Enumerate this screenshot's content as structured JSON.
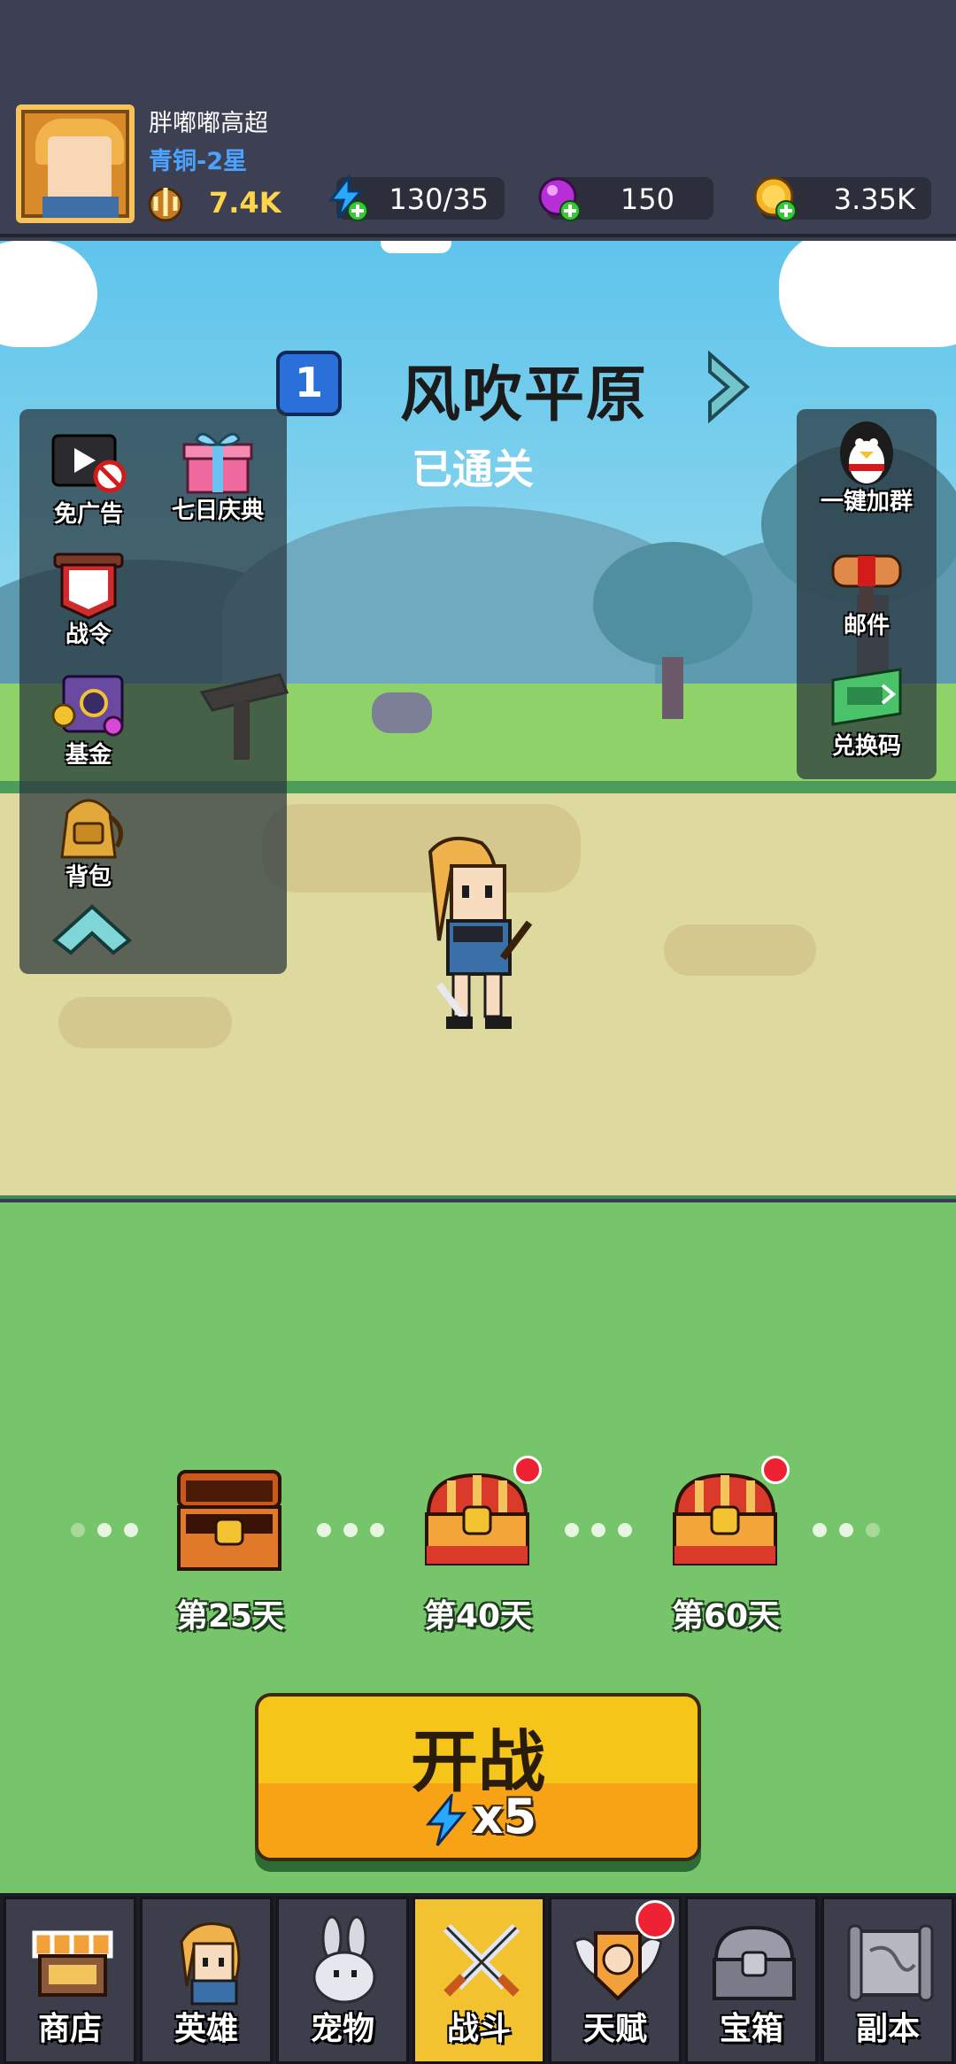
{
  "player": {
    "name": "胖嘟嘟高超",
    "rank": "青铜-2星",
    "power": "7.4K"
  },
  "resources": {
    "energy": "130/35",
    "gems": "150",
    "coins": "3.35K"
  },
  "stage": {
    "number": "1",
    "name": "风吹平原",
    "status": "已通关"
  },
  "left_panel": [
    {
      "label": "免广告",
      "icon": "ad-free-icon"
    },
    {
      "label": "七日庆典",
      "icon": "gift-box-icon"
    },
    {
      "label": "战令",
      "icon": "battle-pass-icon"
    },
    {
      "label": "基金",
      "icon": "fund-safe-icon"
    },
    {
      "label": "背包",
      "icon": "backpack-icon"
    }
  ],
  "right_panel": [
    {
      "label": "一键加群",
      "icon": "penguin-icon"
    },
    {
      "label": "邮件",
      "icon": "mailbox-icon"
    },
    {
      "label": "兑换码",
      "icon": "redeem-ticket-icon"
    }
  ],
  "rewards": [
    {
      "day_label": "第25天",
      "state": "opened"
    },
    {
      "day_label": "第40天",
      "state": "ready"
    },
    {
      "day_label": "第60天",
      "state": "ready"
    }
  ],
  "fight_button": {
    "label": "开战",
    "cost": "x5"
  },
  "nav_tabs": [
    {
      "label": "商店",
      "icon": "shop-icon"
    },
    {
      "label": "英雄",
      "icon": "hero-icon"
    },
    {
      "label": "宠物",
      "icon": "pet-icon"
    },
    {
      "label": "战斗",
      "icon": "crossed-swords-icon"
    },
    {
      "label": "天赋",
      "icon": "talent-icon"
    },
    {
      "label": "宝箱",
      "icon": "chest-icon"
    },
    {
      "label": "副本",
      "icon": "map-scroll-icon"
    }
  ],
  "active_tab": "战斗",
  "colors": {
    "accent_gold": "#f5c51a",
    "rank_blue": "#4aa3ff",
    "power_yellow": "#ffd54a",
    "notify_red": "#ee2233"
  }
}
